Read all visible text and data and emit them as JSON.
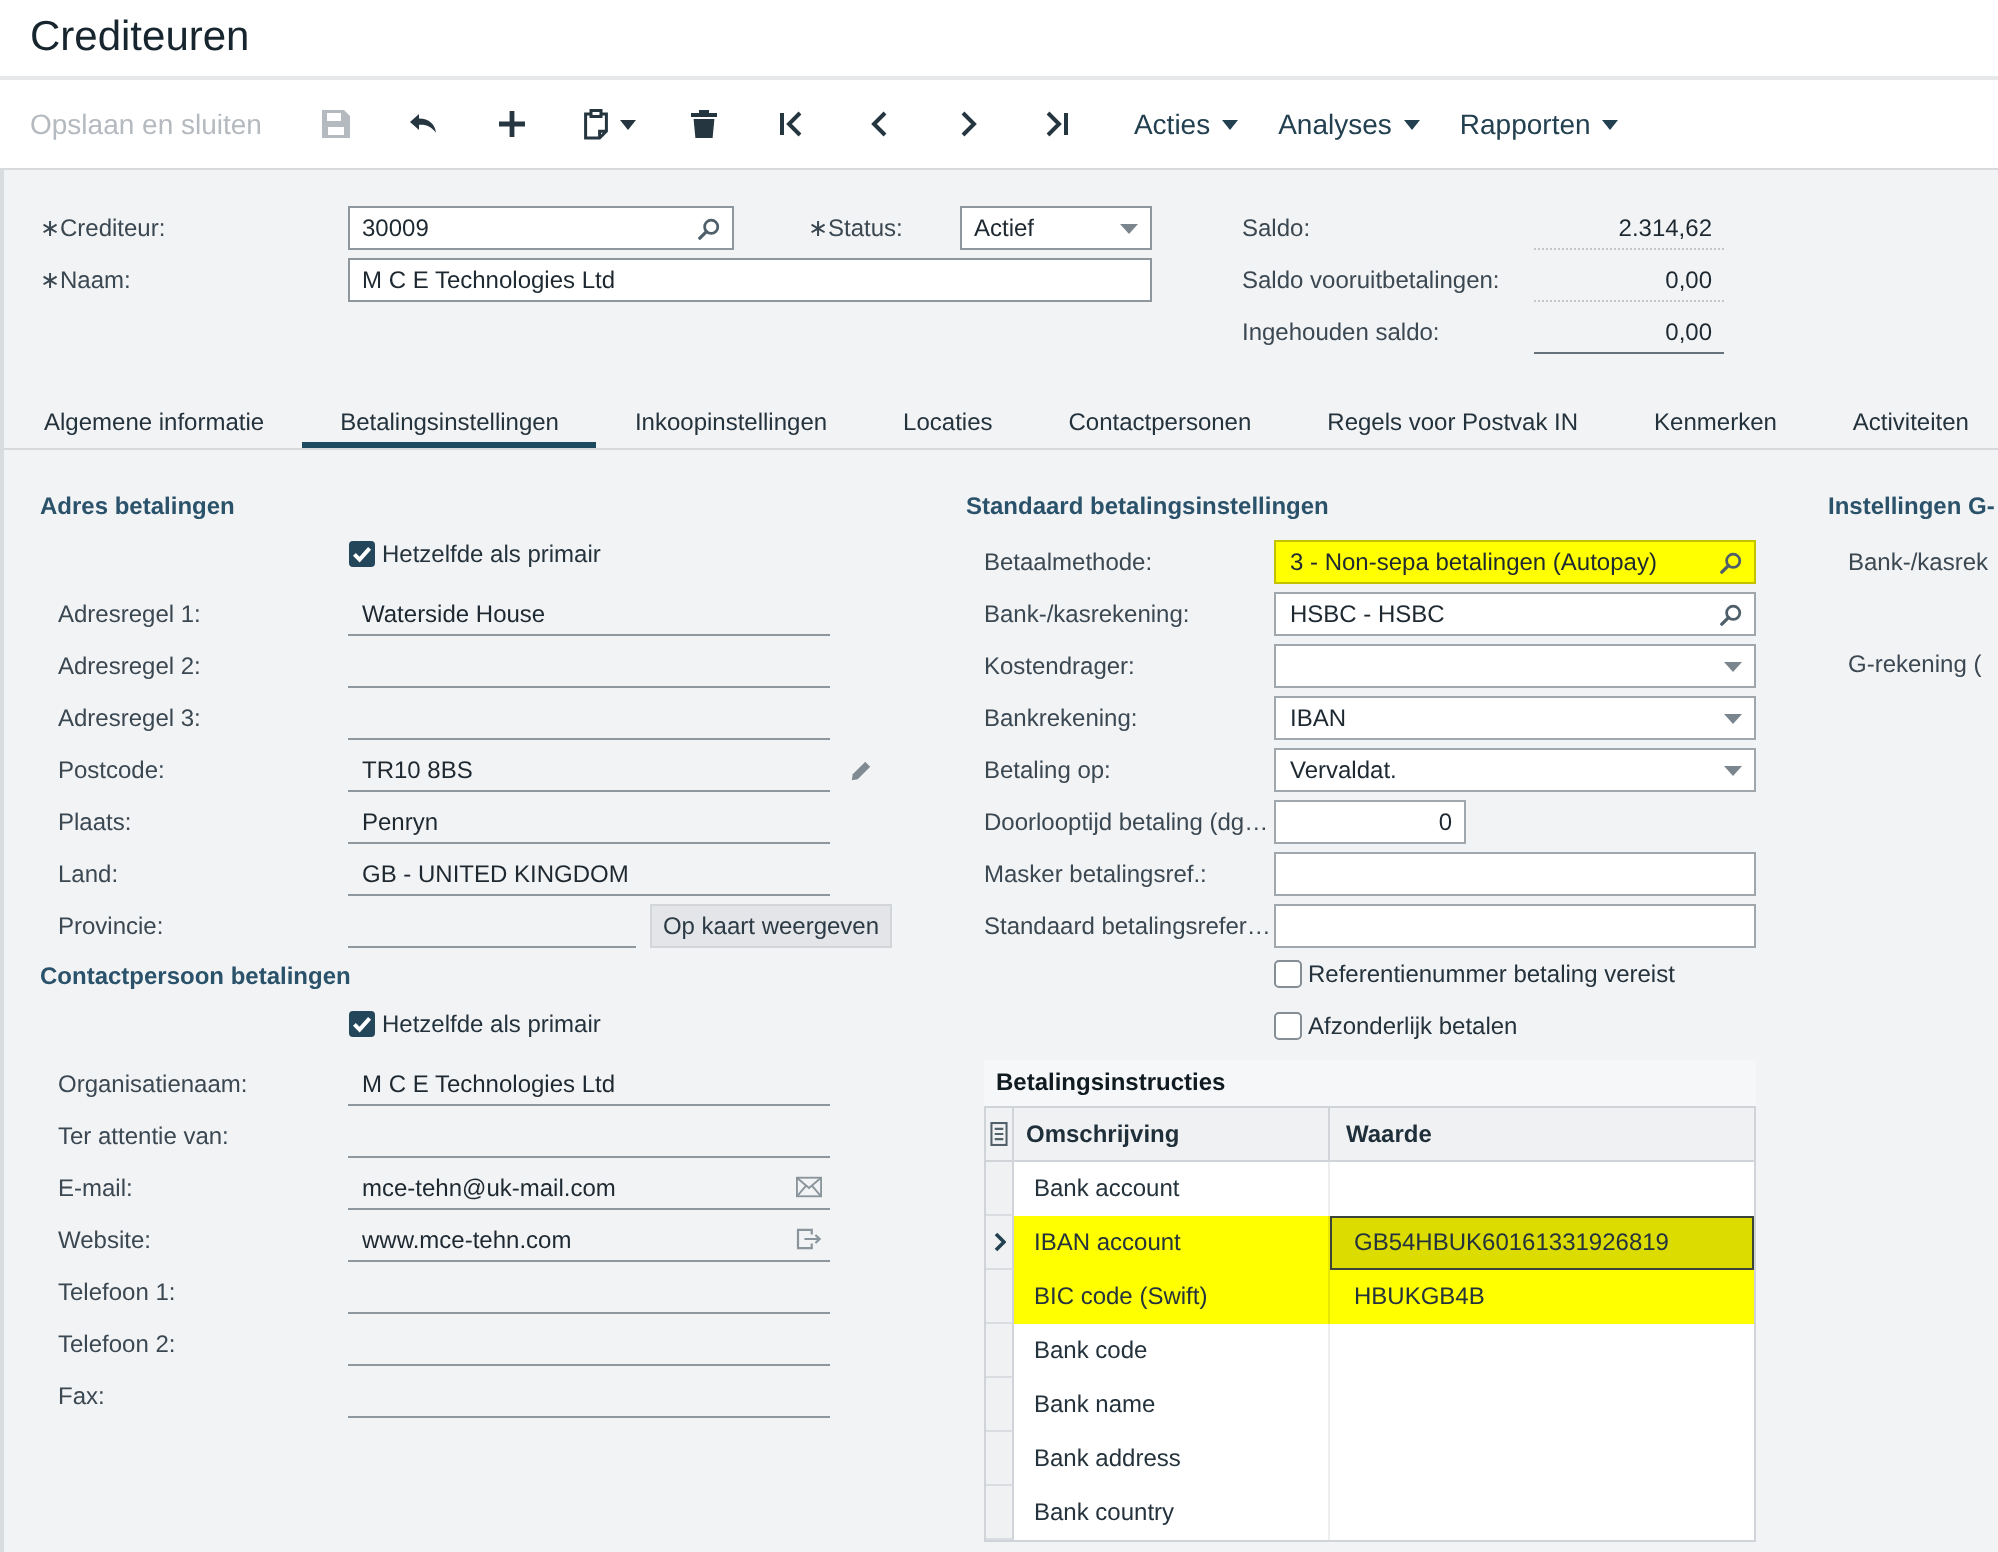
{
  "window": {
    "title": "Crediteuren"
  },
  "toolbar": {
    "save_close": {
      "label": "Opslaan en sluiten",
      "disabled": true
    },
    "buttons": [
      {
        "kind": "save",
        "disabled": true
      },
      {
        "kind": "undo",
        "disabled": false
      },
      {
        "kind": "add",
        "disabled": false
      },
      {
        "kind": "paste",
        "disabled": false
      },
      {
        "kind": "delete",
        "disabled": false
      },
      {
        "kind": "first",
        "disabled": false
      },
      {
        "kind": "previous",
        "disabled": false
      },
      {
        "kind": "next",
        "disabled": false
      },
      {
        "kind": "last",
        "disabled": false
      }
    ],
    "menus": [
      {
        "label": "Acties"
      },
      {
        "label": "Analyses"
      },
      {
        "label": "Rapporten"
      }
    ]
  },
  "header": {
    "vendor": {
      "label": "∗Crediteur:",
      "value": "30009"
    },
    "status": {
      "label": "∗Status:",
      "value": "Actief"
    },
    "name": {
      "label": "∗Naam:",
      "value": "M C E Technologies Ltd"
    },
    "balances": [
      {
        "label": "Saldo:",
        "value": "2.314,62"
      },
      {
        "label": "Saldo vooruitbetalingen:",
        "value": "0,00"
      },
      {
        "label": "Ingehouden saldo:",
        "value": "0,00"
      }
    ]
  },
  "tabs": [
    {
      "label": "Algemene informatie",
      "selected": false
    },
    {
      "label": "Betalingsinstellingen",
      "selected": true
    },
    {
      "label": "Inkoopinstellingen",
      "selected": false
    },
    {
      "label": "Locaties",
      "selected": false
    },
    {
      "label": "Contactpersonen",
      "selected": false
    },
    {
      "label": "Regels voor Postvak IN",
      "selected": false
    },
    {
      "label": "Kenmerken",
      "selected": false
    },
    {
      "label": "Activiteiten",
      "selected": false
    }
  ],
  "address": {
    "title": "Adres betalingen",
    "same_as_primary": {
      "label": "Hetzelfde als primair",
      "checked": true
    },
    "fields": [
      {
        "kind": "text",
        "label": "Adresregel 1:",
        "value": "Waterside House"
      },
      {
        "kind": "text",
        "label": "Adresregel 2:"
      },
      {
        "kind": "text",
        "label": "Adresregel 3:"
      },
      {
        "kind": "edit",
        "label": "Postcode:",
        "value": "TR10 8BS"
      },
      {
        "kind": "text",
        "label": "Plaats:",
        "value": "Penryn"
      },
      {
        "kind": "text",
        "label": "Land:",
        "value": "GB - UNITED KINGDOM"
      },
      {
        "kind": "map",
        "label": "Provincie:",
        "button": "Op kaart weergeven"
      }
    ]
  },
  "contact": {
    "title": "Contactpersoon betalingen",
    "same_as_primary": {
      "label": "Hetzelfde als primair",
      "checked": true
    },
    "fields": [
      {
        "kind": "text",
        "label": "Organisatienaam:",
        "value": "M C E Technologies Ltd"
      },
      {
        "kind": "text",
        "label": "Ter attentie van:"
      },
      {
        "kind": "email",
        "label": "E-mail:",
        "value": "mce-tehn@uk-mail.com"
      },
      {
        "kind": "link",
        "label": "Website:",
        "value": "www.mce-tehn.com"
      },
      {
        "kind": "text",
        "label": "Telefoon 1:"
      },
      {
        "kind": "text",
        "label": "Telefoon 2:"
      },
      {
        "kind": "text",
        "label": "Fax:"
      }
    ]
  },
  "payment": {
    "title": "Standaard betalingsinstellingen",
    "fields": [
      {
        "kind": "lookup",
        "label": "Betaalmethode:",
        "value": "3 - Non-sepa betalingen (Autopay)",
        "highlighted": true
      },
      {
        "kind": "lookup",
        "label": "Bank-/kasrekening:",
        "value": "HSBC - HSBC",
        "highlighted": false
      },
      {
        "kind": "select",
        "label": "Kostendrager:",
        "highlighted": false
      },
      {
        "kind": "select",
        "label": "Bankrekening:",
        "value": "IBAN",
        "highlighted": false
      },
      {
        "kind": "select",
        "label": "Betaling op:",
        "value": "Vervaldat.",
        "highlighted": false
      },
      {
        "kind": "number",
        "label": "Doorlooptijd betaling (dg…",
        "value": "0",
        "highlighted": false
      },
      {
        "kind": "text",
        "label": "Masker betalingsref.:",
        "highlighted": false
      },
      {
        "kind": "text",
        "label": "Standaard betalingsrefer…",
        "highlighted": false
      }
    ],
    "checkboxes": [
      {
        "label": "Referentienummer betaling vereist",
        "checked": false
      },
      {
        "label": "Afzonderlijk betalen",
        "checked": false
      }
    ]
  },
  "instructions": {
    "title": "Betalingsinstructies",
    "columns": [
      "Omschrijving",
      "Waarde"
    ],
    "rows": [
      {
        "description": "Bank account",
        "selected": false,
        "highlighted": false
      },
      {
        "description": "IBAN account",
        "value": "GB54HBUK60161331926819",
        "selected": true,
        "highlighted": true
      },
      {
        "description": "BIC code (Swift)",
        "value": "HBUKGB4B",
        "selected": false,
        "highlighted": true
      },
      {
        "description": "Bank code",
        "selected": false,
        "highlighted": false
      },
      {
        "description": "Bank name",
        "selected": false,
        "highlighted": false
      },
      {
        "description": "Bank address",
        "selected": false,
        "highlighted": false
      },
      {
        "description": "Bank country",
        "selected": false,
        "highlighted": false
      }
    ]
  },
  "section_3": {
    "title": "Instellingen G-",
    "labels": [
      "Bank-/kasrek",
      "G-rekening ("
    ]
  }
}
